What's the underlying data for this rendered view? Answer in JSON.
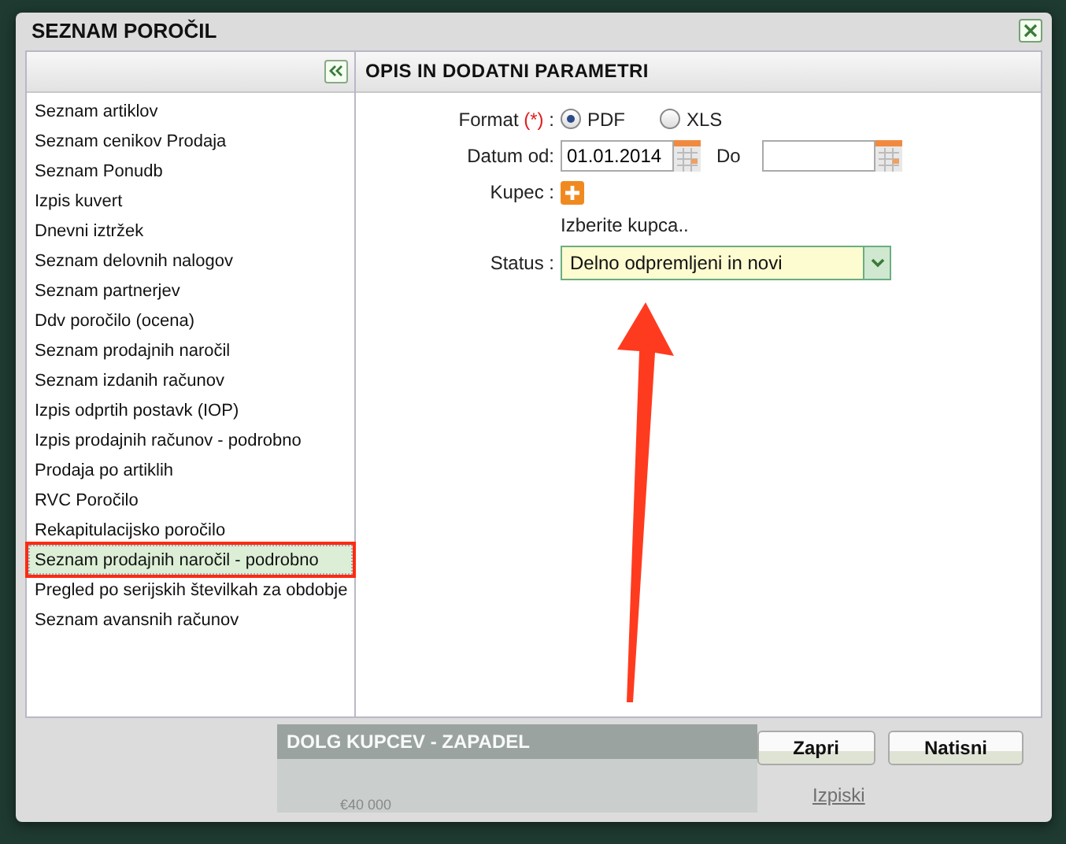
{
  "dialog": {
    "title": "SEZNAM POROČIL"
  },
  "left_panel": {
    "items": [
      {
        "label": "Seznam artiklov",
        "selected": false
      },
      {
        "label": "Seznam cenikov Prodaja",
        "selected": false
      },
      {
        "label": "Seznam Ponudb",
        "selected": false
      },
      {
        "label": "Izpis kuvert",
        "selected": false
      },
      {
        "label": "Dnevni iztržek",
        "selected": false
      },
      {
        "label": "Seznam delovnih nalogov",
        "selected": false
      },
      {
        "label": "Seznam partnerjev",
        "selected": false
      },
      {
        "label": "Ddv poročilo (ocena)",
        "selected": false
      },
      {
        "label": "Seznam prodajnih naročil",
        "selected": false
      },
      {
        "label": "Seznam izdanih računov",
        "selected": false
      },
      {
        "label": "Izpis odprtih postavk (IOP)",
        "selected": false
      },
      {
        "label": "Izpis prodajnih računov - podrobno",
        "selected": false
      },
      {
        "label": "Prodaja po artiklih",
        "selected": false
      },
      {
        "label": "RVC Poročilo",
        "selected": false
      },
      {
        "label": "Rekapitulacijsko poročilo",
        "selected": false
      },
      {
        "label": "Seznam prodajnih naročil - podrobno",
        "selected": true
      },
      {
        "label": "Pregled po serijskih številkah za obdobje",
        "selected": false
      },
      {
        "label": "Seznam avansnih računov",
        "selected": false
      }
    ]
  },
  "right_panel": {
    "title": "OPIS IN DODATNI PARAMETRI",
    "format": {
      "label": "Format",
      "required_mark": "(*)",
      "colon": ":",
      "options": [
        {
          "label": "PDF",
          "selected": true
        },
        {
          "label": "XLS",
          "selected": false
        }
      ]
    },
    "date_from": {
      "label": "Datum od:",
      "value": "01.01.2014"
    },
    "date_to": {
      "label": "Do"
    },
    "customer": {
      "label": "Kupec :",
      "hint": "Izberite kupca.."
    },
    "status": {
      "label": "Status :",
      "value": "Delno odpremljeni in novi"
    }
  },
  "background": {
    "panel_title": "DOLG KUPCEV - ZAPADEL",
    "axis_label": "€40 000",
    "link": "Izpiski"
  },
  "buttons": [
    "Zapri",
    "Natisni"
  ]
}
